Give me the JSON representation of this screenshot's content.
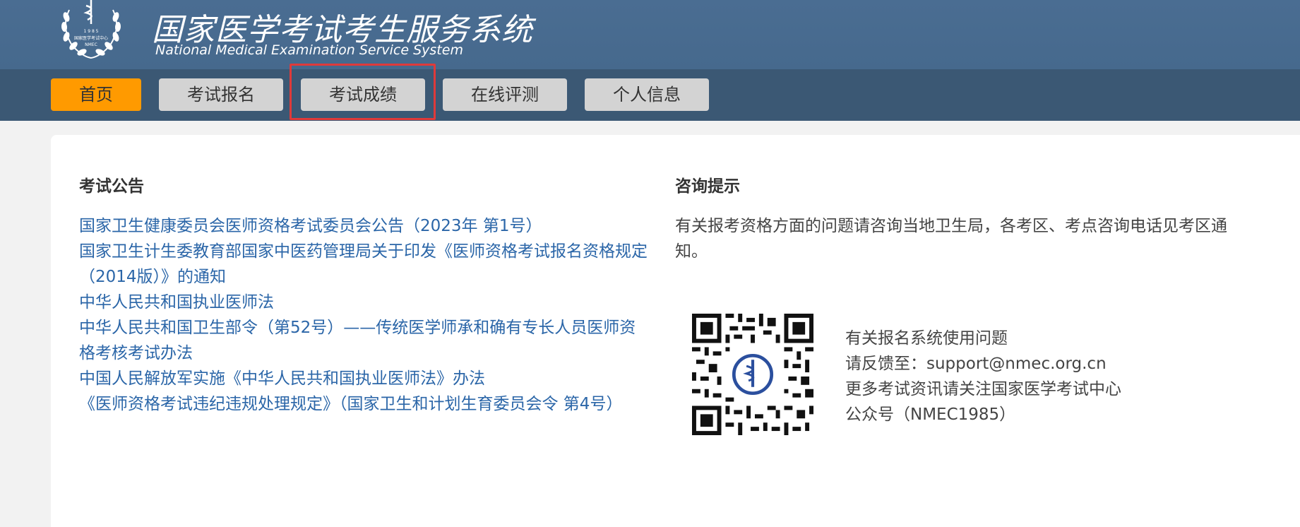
{
  "header": {
    "title_cn": "国家医学考试考生服务系统",
    "title_en": "National Medical Examination Service System",
    "logo_text_top": "国家医学考试中心",
    "logo_text_bottom": "NMEC",
    "logo_year": "1 9 8 5"
  },
  "nav": {
    "items": [
      {
        "label": "首页",
        "active": true
      },
      {
        "label": "考试报名",
        "active": false
      },
      {
        "label": "考试成绩",
        "active": false
      },
      {
        "label": "在线评测",
        "active": false
      },
      {
        "label": "个人信息",
        "active": false
      }
    ]
  },
  "announcements": {
    "title": "考试公告",
    "items": [
      "国家卫生健康委员会医师资格考试委员会公告（2023年 第1号）",
      "国家卫生计生委教育部国家中医药管理局关于印发《医师资格考试报名资格规定（2014版）》的通知",
      "中华人民共和国执业医师法",
      "中华人民共和国卫生部令（第52号）——传统医学师承和确有专长人员医师资格考核考试办法",
      "中国人民解放军实施《中华人民共和国执业医师法》办法",
      "《医师资格考试违纪违规处理规定》（国家卫生和计划生育委员会令 第4号）"
    ]
  },
  "consult": {
    "title": "咨询提示",
    "text": "有关报考资格方面的问题请咨询当地卫生局，各考区、考点咨询电话见考区通知。",
    "contact_lines": [
      "有关报名系统使用问题",
      "请反馈至：support@nmec.org.cn",
      "更多考试资讯请关注国家医学考试中心",
      "公众号（NMEC1985）"
    ]
  },
  "colors": {
    "header_bg": "#4a6d92",
    "navbar_bg": "#3b5874",
    "nav_active": "#ff9a00",
    "nav_inactive": "#d3d3d3",
    "link": "#2b66a8",
    "highlight": "#e03a3a"
  }
}
